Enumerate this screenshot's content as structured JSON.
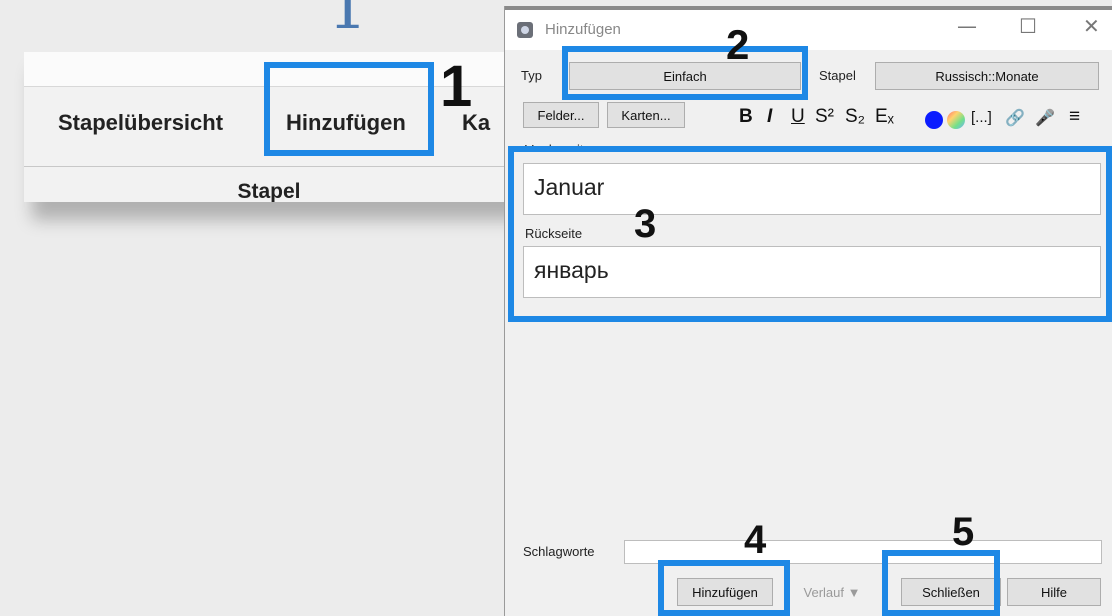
{
  "callouts": {
    "top_fragment": "1",
    "n1": "1",
    "n2": "2",
    "n3": "3",
    "n4": "4",
    "n5": "5"
  },
  "main_window": {
    "nav": [
      "Stapelübersicht",
      "Hinzufügen",
      "Ka"
    ],
    "subheading": "Stapel"
  },
  "dialog": {
    "title": "Hinzufügen",
    "window_controls": {
      "minimize": "—",
      "maximize": "☐",
      "close": "✕"
    },
    "type_label": "Typ",
    "type_value": "Einfach",
    "deck_label": "Stapel",
    "deck_value": "Russisch::Monate",
    "fields_button": "Felder...",
    "cards_button": "Karten...",
    "format_toolbar": {
      "bold": "B",
      "italic": "I",
      "underline": "U",
      "superscript": "S²",
      "subscript": "S₂",
      "clear_format": "Eₓ",
      "text_color": "#0b1cff",
      "cloze": "[...]",
      "attach": "🔗",
      "record": "🎤",
      "more": "≡",
      "icons": [
        "paperclip-icon",
        "microphone-icon",
        "menu-icon"
      ]
    },
    "front_label": "Vorderseite",
    "front_value": "Januar",
    "back_label": "Rückseite",
    "back_value": "январь",
    "tags_label": "Schlagworte",
    "tags_value": "",
    "add_button": "Hinzufügen",
    "history_button": "Verlauf ▼",
    "close_button": "Schließen",
    "help_button": "Hilfe"
  },
  "colors": {
    "highlight": "#1e88e5",
    "top_number": "#4a78b0"
  }
}
